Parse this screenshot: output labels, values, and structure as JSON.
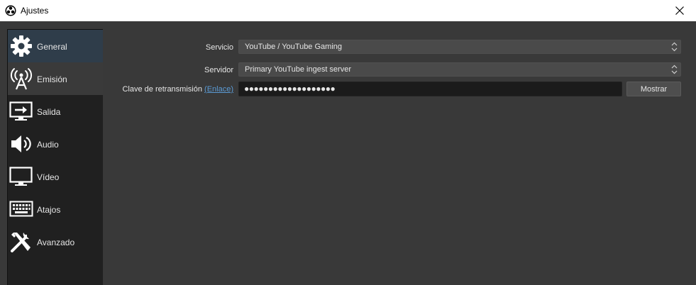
{
  "window": {
    "title": "Ajustes",
    "app_icon": "obs-logo-icon",
    "close_icon": "close-icon"
  },
  "sidebar": {
    "items": [
      {
        "label": "General",
        "icon": "gear-icon",
        "state": "selected"
      },
      {
        "label": "Emisión",
        "icon": "broadcast-antenna-icon",
        "state": "hovered"
      },
      {
        "label": "Salida",
        "icon": "monitor-output-icon",
        "state": "normal"
      },
      {
        "label": "Audio",
        "icon": "speaker-icon",
        "state": "normal"
      },
      {
        "label": "Vídeo",
        "icon": "monitor-icon",
        "state": "normal"
      },
      {
        "label": "Atajos",
        "icon": "keyboard-icon",
        "state": "normal"
      },
      {
        "label": "Avanzado",
        "icon": "tools-icon",
        "state": "normal"
      }
    ]
  },
  "form": {
    "service_label": "Servicio",
    "service_value": "YouTube / YouTube Gaming",
    "server_label": "Servidor",
    "server_value": "Primary YouTube ingest server",
    "key_label": "Clave de retransmisión",
    "key_link": "(Enlace)",
    "key_value": "●●●●●●●●●●●●●●●●●●●",
    "show_button": "Mostrar"
  },
  "colors": {
    "selected_bg": "#2f3d4a",
    "link": "#5b9bd5",
    "panel_bg": "#393939",
    "sidebar_bg": "#202020"
  }
}
